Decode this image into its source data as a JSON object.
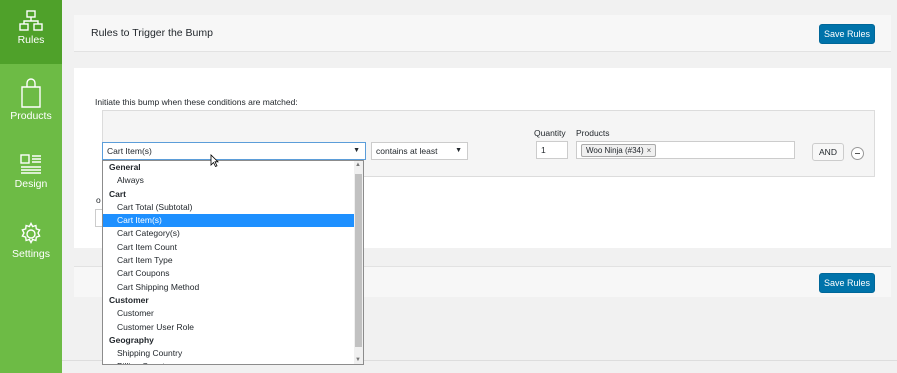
{
  "sidebar": {
    "items": [
      {
        "label": "Rules",
        "icon": "rules-icon"
      },
      {
        "label": "Products",
        "icon": "bag-icon"
      },
      {
        "label": "Design",
        "icon": "design-icon"
      },
      {
        "label": "Settings",
        "icon": "gear-icon"
      }
    ],
    "color": "#6dbb45",
    "active_color": "#4fa12a"
  },
  "header": {
    "title": "Rules to Trigger the Bump",
    "save_label": "Save Rules"
  },
  "rules": {
    "heading": "Initiate this bump when these conditions are matched:",
    "condition_value": "Cart Item(s)",
    "operator_value": "contains at least",
    "quantity_label": "Quantity",
    "quantity_value": "1",
    "products_label": "Products",
    "product_tag": "Woo Ninja (#34)",
    "product_tag_remove": "×",
    "and_label": "AND",
    "or_label": "o"
  },
  "dropdown": {
    "rows": [
      {
        "text": "General",
        "kind": "group"
      },
      {
        "text": "Always",
        "kind": "opt"
      },
      {
        "text": "Cart",
        "kind": "group"
      },
      {
        "text": "Cart Total (Subtotal)",
        "kind": "opt"
      },
      {
        "text": "Cart Item(s)",
        "kind": "opt",
        "selected": true
      },
      {
        "text": "Cart Category(s)",
        "kind": "opt"
      },
      {
        "text": "Cart Item Count",
        "kind": "opt"
      },
      {
        "text": "Cart Item Type",
        "kind": "opt"
      },
      {
        "text": "Cart Coupons",
        "kind": "opt"
      },
      {
        "text": "Cart Shipping Method",
        "kind": "opt"
      },
      {
        "text": "Customer",
        "kind": "group"
      },
      {
        "text": "Customer",
        "kind": "opt"
      },
      {
        "text": "Customer User Role",
        "kind": "opt"
      },
      {
        "text": "Geography",
        "kind": "group"
      },
      {
        "text": "Shipping Country",
        "kind": "opt"
      },
      {
        "text": "Billing Country",
        "kind": "opt"
      }
    ],
    "selected_color": "#1e90ff"
  },
  "footer": {
    "save_label": "Save Rules"
  },
  "colors": {
    "button": "#0073aa"
  }
}
